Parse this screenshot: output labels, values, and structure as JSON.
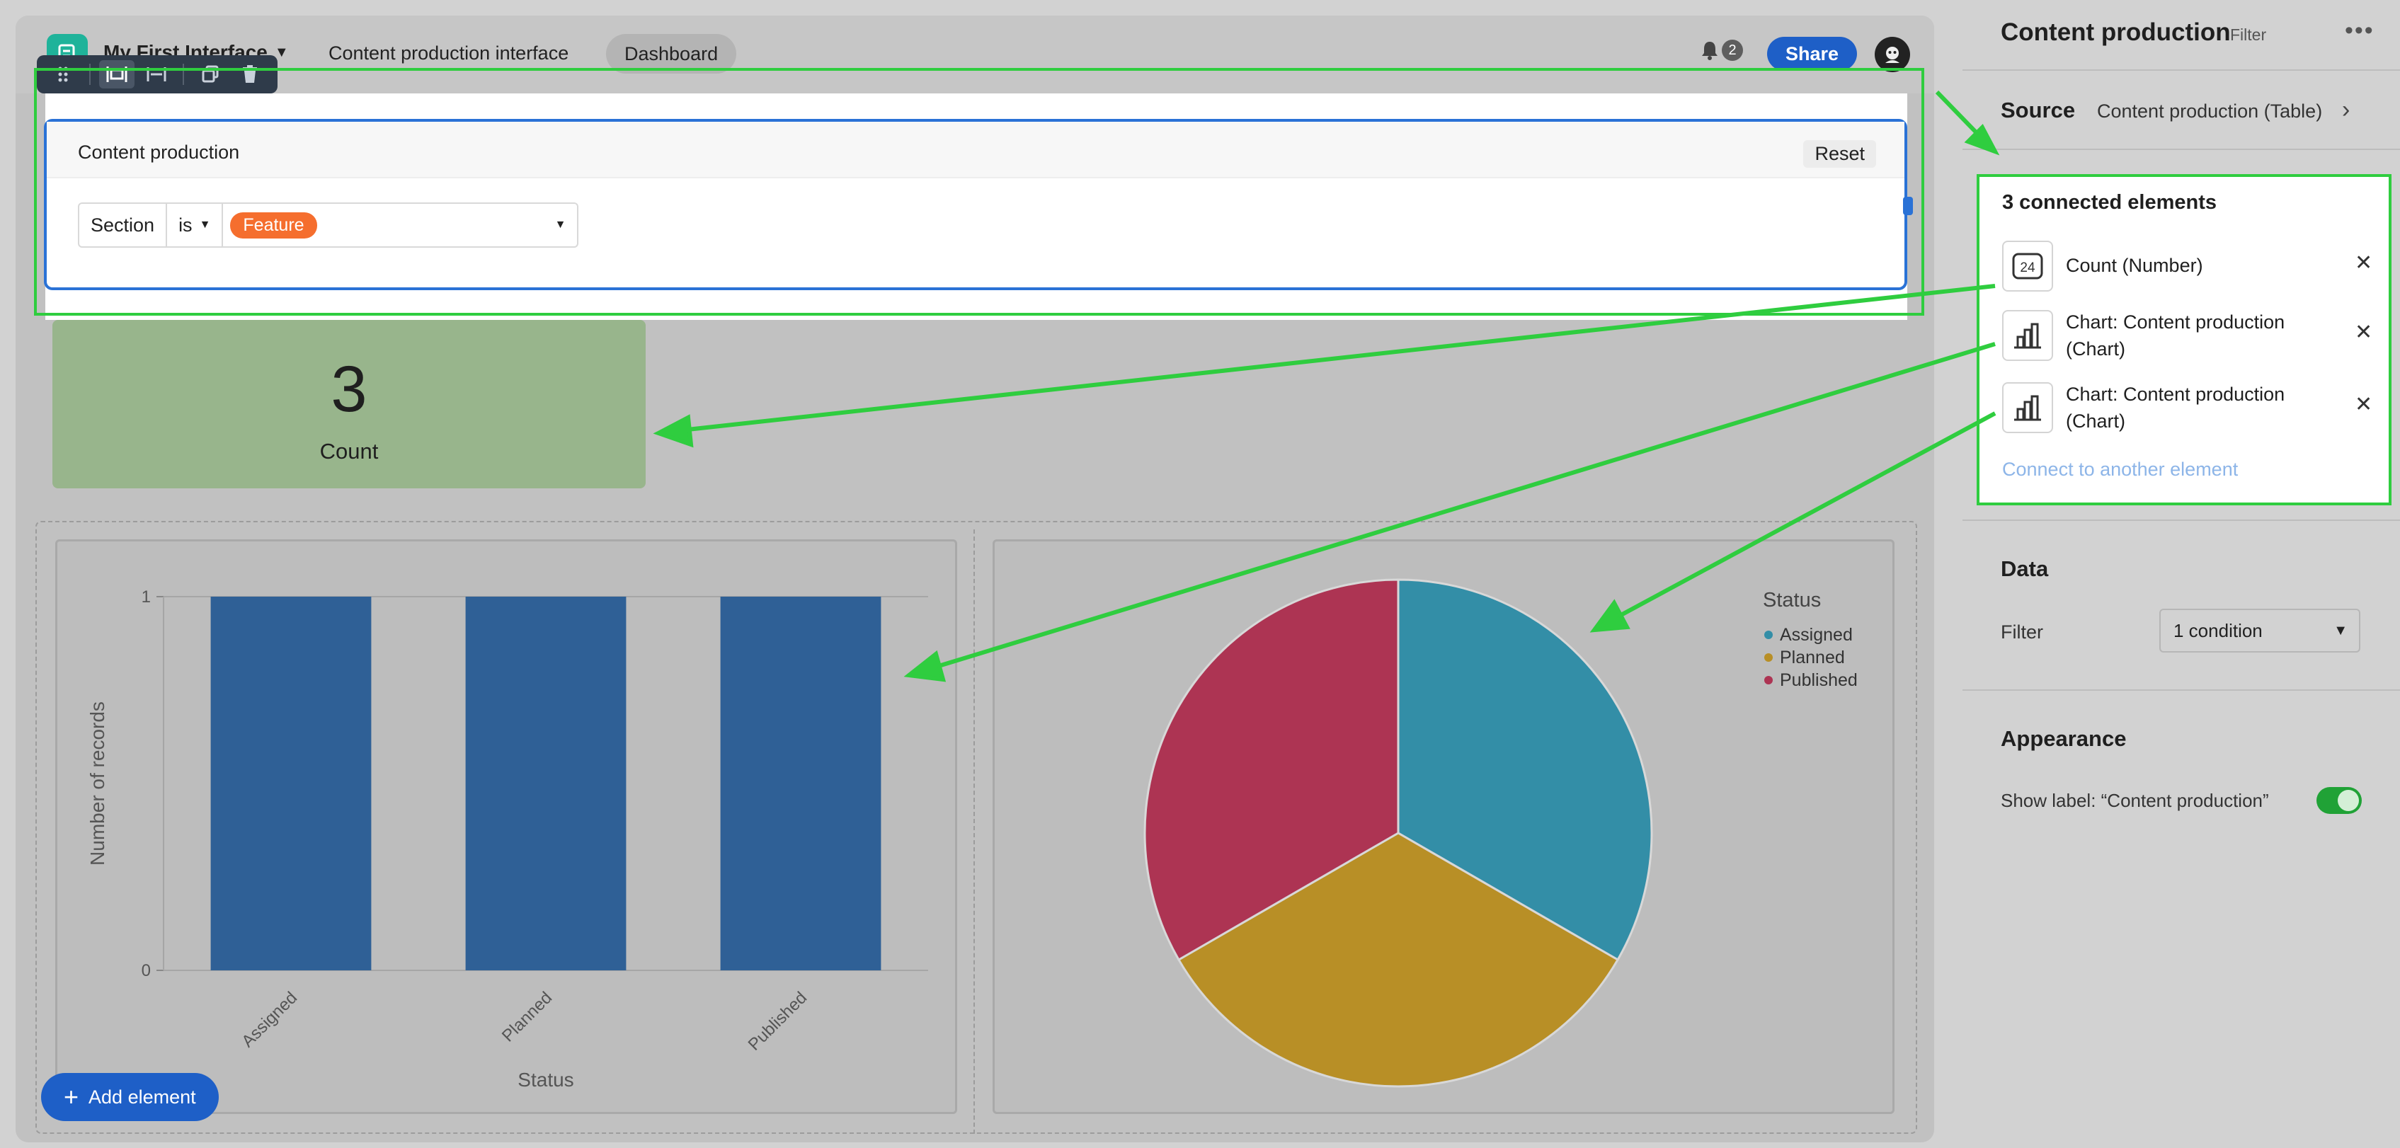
{
  "header": {
    "app_name": "My First Interface",
    "nav_link": "Content production interface",
    "active_tab": "Dashboard",
    "notification_count": "2",
    "share_label": "Share"
  },
  "filter_element": {
    "title": "Content production",
    "reset_label": "Reset",
    "field": "Section",
    "operator": "is",
    "value": "Feature"
  },
  "count_card": {
    "value": "3",
    "label": "Count"
  },
  "bar_chart": {
    "xlabel": "Status",
    "ylabel": "Number of records"
  },
  "chart_data": [
    {
      "type": "bar",
      "categories": [
        "Assigned",
        "Planned",
        "Published"
      ],
      "values": [
        1,
        1,
        1
      ],
      "xlabel": "Status",
      "ylabel": "Number of records",
      "ylim": [
        0,
        1
      ],
      "yticks": [
        "0",
        "1"
      ],
      "color": "#2f6096",
      "grid": true
    },
    {
      "type": "pie",
      "legend_title": "Status",
      "legend_position": "top-right",
      "labels": [
        "Assigned",
        "Planned",
        "Published"
      ],
      "values": [
        1,
        1,
        1
      ],
      "colors": [
        "#338ea7",
        "#b88f26",
        "#ad3453"
      ]
    }
  ],
  "add_button_label": "Add element",
  "panel": {
    "title": "Content production",
    "title_tag": "Filter",
    "source_label": "Source",
    "source_value": "Content production (Table)",
    "connected_title": "3 connected elements",
    "connected_items": [
      {
        "label": "Count (Number)",
        "icon": "number-24-icon"
      },
      {
        "label": "Chart: Content production (Chart)",
        "icon": "bar-chart-icon"
      },
      {
        "label": "Chart: Content production (Chart)",
        "icon": "bar-chart-icon"
      }
    ],
    "connect_link": "Connect to another element",
    "data_title": "Data",
    "filter_label": "Filter",
    "filter_value": "1 condition",
    "appearance_title": "Appearance",
    "show_label": "Show label: “Content production”"
  },
  "colors": {
    "accent_blue": "#1e5fc7",
    "highlight_green": "#2fcd3f",
    "feature_orange": "#f56e2e",
    "count_green": "#98b58c"
  }
}
